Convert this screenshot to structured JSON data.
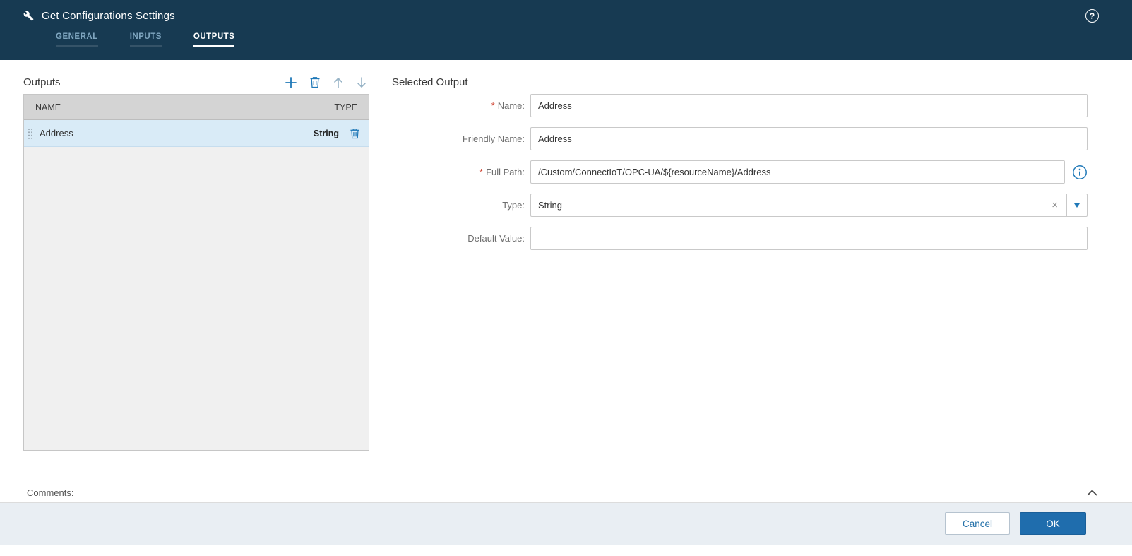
{
  "header": {
    "title": "Get Configurations Settings",
    "tabs": [
      {
        "label": "GENERAL"
      },
      {
        "label": "INPUTS"
      },
      {
        "label": "OUTPUTS"
      }
    ],
    "active_tab": "OUTPUTS"
  },
  "outputs_panel": {
    "title": "Outputs",
    "columns": {
      "name": "NAME",
      "type": "TYPE"
    },
    "rows": [
      {
        "name": "Address",
        "type": "String",
        "selected": true
      }
    ]
  },
  "form": {
    "title": "Selected Output",
    "required_marker": "*",
    "name": {
      "label": "Name:",
      "required": true,
      "value": "Address"
    },
    "friendly_name": {
      "label": "Friendly Name:",
      "required": false,
      "value": "Address"
    },
    "full_path": {
      "label": "Full Path:",
      "required": true,
      "value": "/Custom/ConnectIoT/OPC-UA/${resourceName}/Address"
    },
    "type": {
      "label": "Type:",
      "required": false,
      "value": "String"
    },
    "default_value": {
      "label": "Default Value:",
      "required": false,
      "value": ""
    }
  },
  "comments": {
    "label": "Comments:"
  },
  "footer": {
    "cancel_label": "Cancel",
    "ok_label": "OK"
  },
  "icons": {
    "wrench": "wrench",
    "help": "?",
    "add": "+",
    "delete": "trash",
    "move_up": "↑",
    "move_down": "↓",
    "drag_handle": "⋮⋮",
    "info": "i",
    "clear": "×",
    "dropdown": "▼",
    "collapse": "︿"
  },
  "colors": {
    "header_bg": "#173a52",
    "accent_blue": "#2079b8",
    "selected_row_bg": "#d9ebf7",
    "table_header_bg": "#d4d4d4",
    "ok_button_bg": "#1f6dad",
    "footer_bg": "#e9eef3",
    "required_marker": "#cf4332"
  }
}
